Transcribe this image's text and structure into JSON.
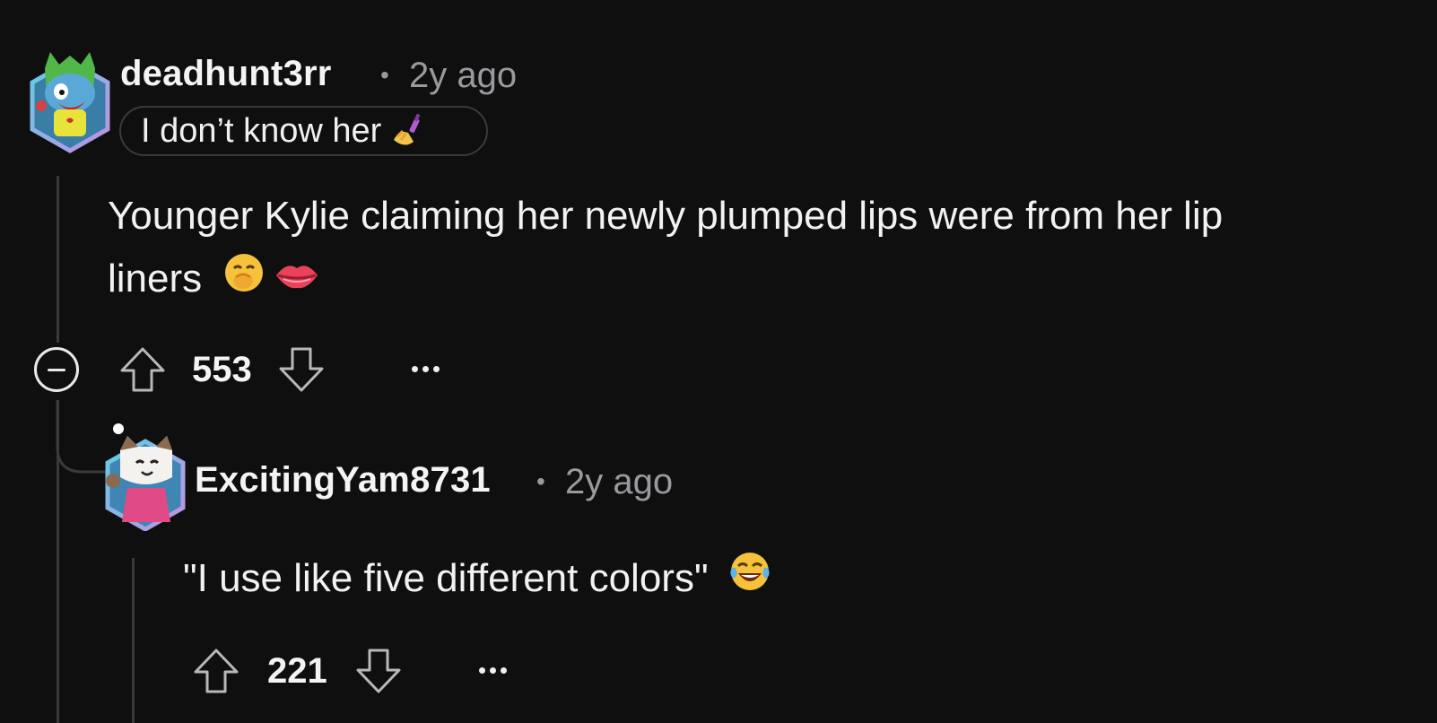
{
  "comments": [
    {
      "username": "deadhunt3rr",
      "separator": "•",
      "time": "2y ago",
      "flair": {
        "text": "I don’t know her",
        "emoji_icon": "nail-polish-icon"
      },
      "body_line1": "Younger Kylie claiming her newly plumped lips were from her lip",
      "body_line2": "liners",
      "body_emojis": [
        "face-with-hand-over-mouth-icon",
        "lips-icon"
      ],
      "score": "553",
      "avatar_icon": "green-monster-avatar-icon"
    },
    {
      "username": "ExcitingYam8731",
      "separator": "•",
      "time": "2y ago",
      "body": "\"I use like five different colors\"",
      "body_emojis": [
        "face-with-tears-of-joy-icon"
      ],
      "score": "221",
      "avatar_icon": "cat-avatar-icon"
    }
  ],
  "colors": {
    "background": "#0f0f10",
    "text": "#f2f2f2",
    "muted": "#9a9a9e",
    "thread_line": "#3a3a3c"
  }
}
